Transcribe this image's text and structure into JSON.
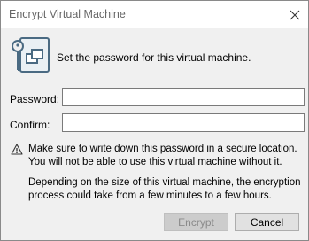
{
  "window": {
    "title": "Encrypt Virtual Machine"
  },
  "header": {
    "description": "Set the password for this virtual machine."
  },
  "form": {
    "password_label": "Password:",
    "password_value": "",
    "confirm_label": "Confirm:",
    "confirm_value": ""
  },
  "warning": {
    "text": "Make sure to write down this password in a secure location. You will not be able to use this virtual machine without it.",
    "note": "Depending on the size of this virtual machine, the encryption process could take from a few minutes to a few hours."
  },
  "buttons": {
    "encrypt_label": "Encrypt",
    "encrypt_enabled": false,
    "cancel_label": "Cancel"
  },
  "icons": {
    "header": "vm-key-icon",
    "warning": "warning-triangle-icon",
    "close": "close-icon"
  },
  "colors": {
    "icon_accent": "#4a6a82"
  }
}
